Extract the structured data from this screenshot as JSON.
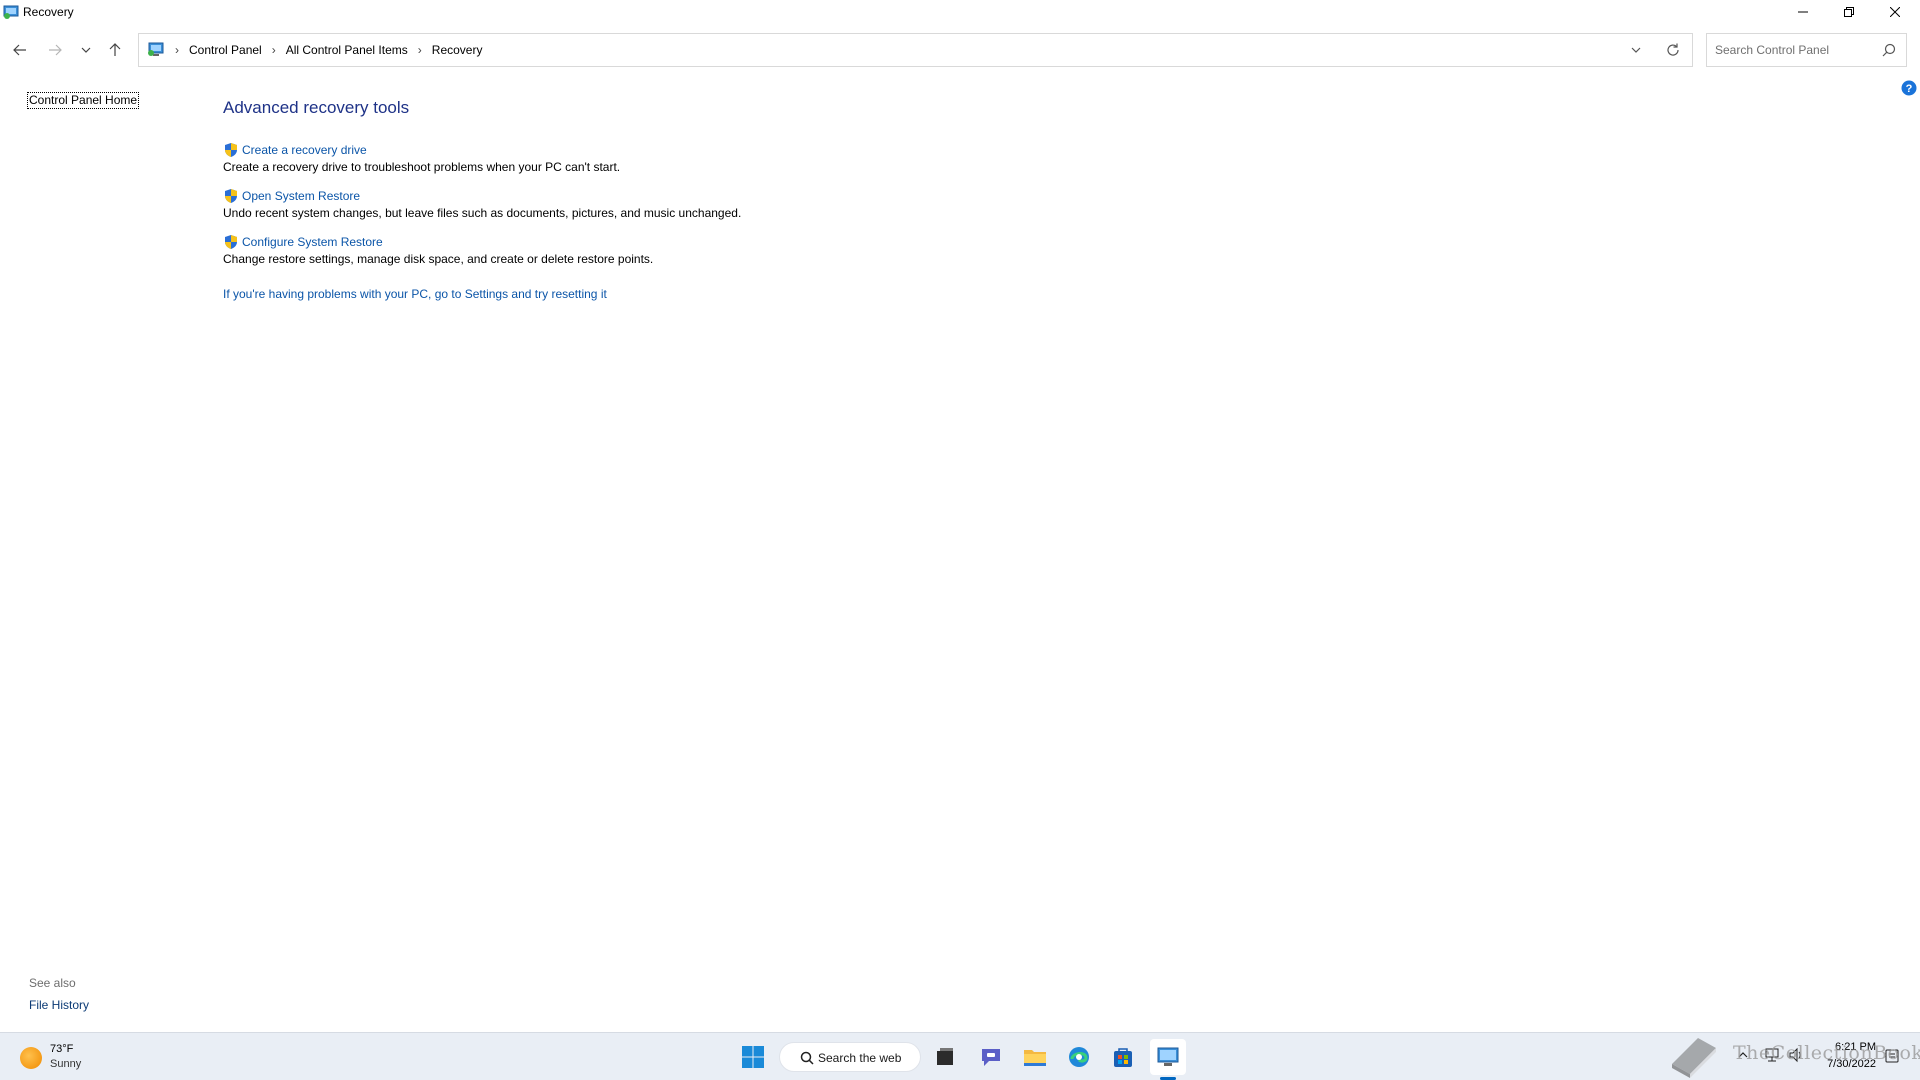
{
  "window": {
    "title": "Recovery"
  },
  "nav": {
    "breadcrumbs": [
      "Control Panel",
      "All Control Panel Items",
      "Recovery"
    ]
  },
  "search": {
    "placeholder": "Search Control Panel"
  },
  "left_pane": {
    "home_link": "Control Panel Home",
    "see_also_label": "See also",
    "see_also_items": [
      "File History"
    ]
  },
  "main": {
    "heading": "Advanced recovery tools",
    "tools": [
      {
        "label": "Create a recovery drive",
        "description": "Create a recovery drive to troubleshoot problems when your PC can't start."
      },
      {
        "label": "Open System Restore",
        "description": "Undo recent system changes, but leave files such as documents, pictures, and music unchanged."
      },
      {
        "label": "Configure System Restore",
        "description": "Change restore settings, manage disk space, and create or delete restore points."
      }
    ],
    "reset_link": "If you're having problems with your PC, go to Settings and try resetting it"
  },
  "taskbar": {
    "weather": {
      "temp": "73°F",
      "condition": "Sunny"
    },
    "search_label": "Search the web",
    "clock": {
      "time": "6:21 PM",
      "date": "7/30/2022"
    },
    "watermark": "TheCollectionBook"
  },
  "colors": {
    "link": "#0b55a8",
    "heading": "#1e3287",
    "taskbar_bg": "#e9eef5",
    "accent": "#0067c0"
  }
}
